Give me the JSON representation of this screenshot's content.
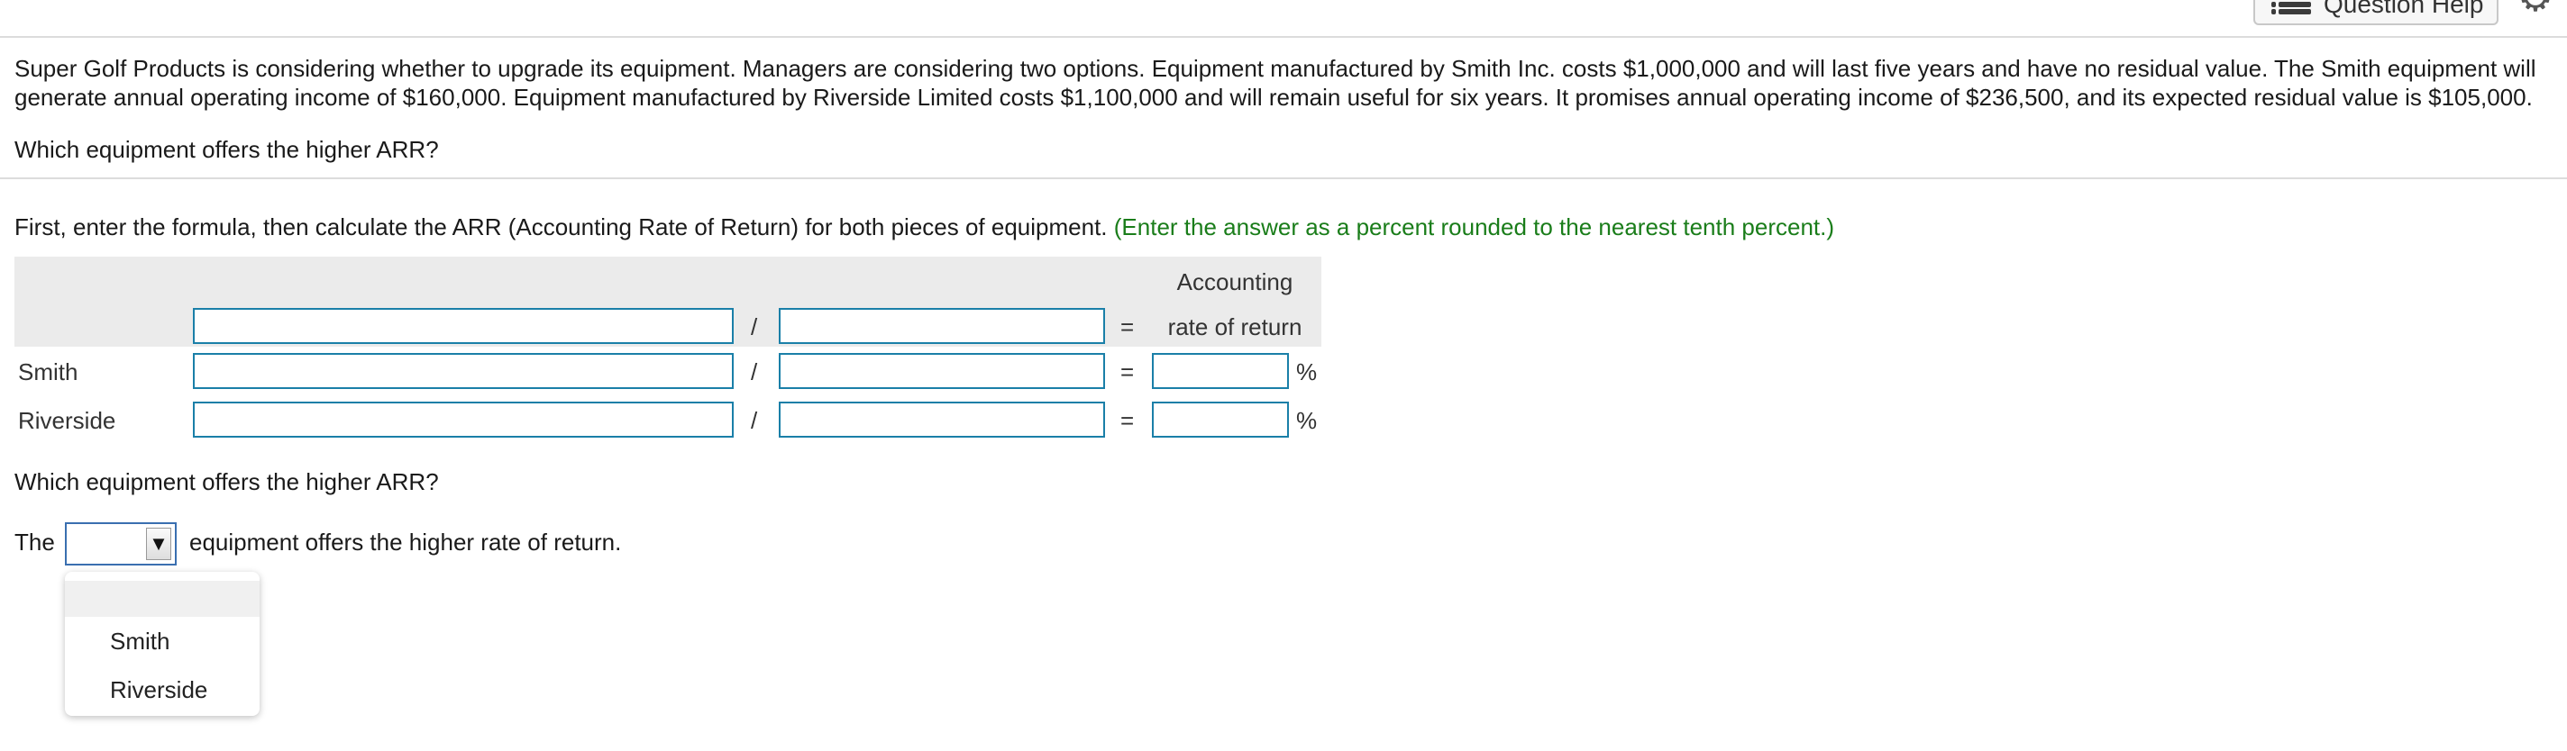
{
  "header": {
    "help_label": "Question Help",
    "help_icon": "list-icon",
    "settings_icon": "gear-icon"
  },
  "problem": {
    "line1": "Super Golf Products is considering whether to upgrade its equipment. Managers are considering two options. Equipment manufactured by Smith Inc. costs $1,000,000 and will last five years and have no residual value. The Smith equipment will",
    "line2": "generate annual operating income of $160,000. Equipment manufactured by Riverside Limited costs $1,100,000 and will remain useful for six years. It promises annual operating income of $236,500, and its expected residual value is $105,000.",
    "question": "Which equipment offers the higher ARR?"
  },
  "instruction": {
    "text": "First, enter the formula, then calculate the ARR (Accounting Rate of Return) for both pieces of equipment.",
    "hint": "(Enter the answer as a percent rounded to the nearest tenth percent.)"
  },
  "table": {
    "col_head_line1": "Accounting",
    "col_head_line2": "rate of return",
    "divide_symbol": "/",
    "equals_symbol": "=",
    "percent_symbol": "%",
    "rows": [
      {
        "label": "Smith",
        "numerator": "",
        "denominator": "",
        "result": ""
      },
      {
        "label": "Riverside",
        "numerator": "",
        "denominator": "",
        "result": ""
      }
    ],
    "formula": {
      "numerator": "",
      "denominator": ""
    }
  },
  "answer": {
    "question": "Which equipment offers the higher ARR?",
    "prefix": "The",
    "suffix": "equipment offers the higher rate of return.",
    "selected": "",
    "options": [
      "Smith",
      "Riverside"
    ]
  },
  "colors": {
    "input_border": "#1a7fa8",
    "hint_green": "#1a7d1a",
    "select_border": "#3a6fb0"
  }
}
